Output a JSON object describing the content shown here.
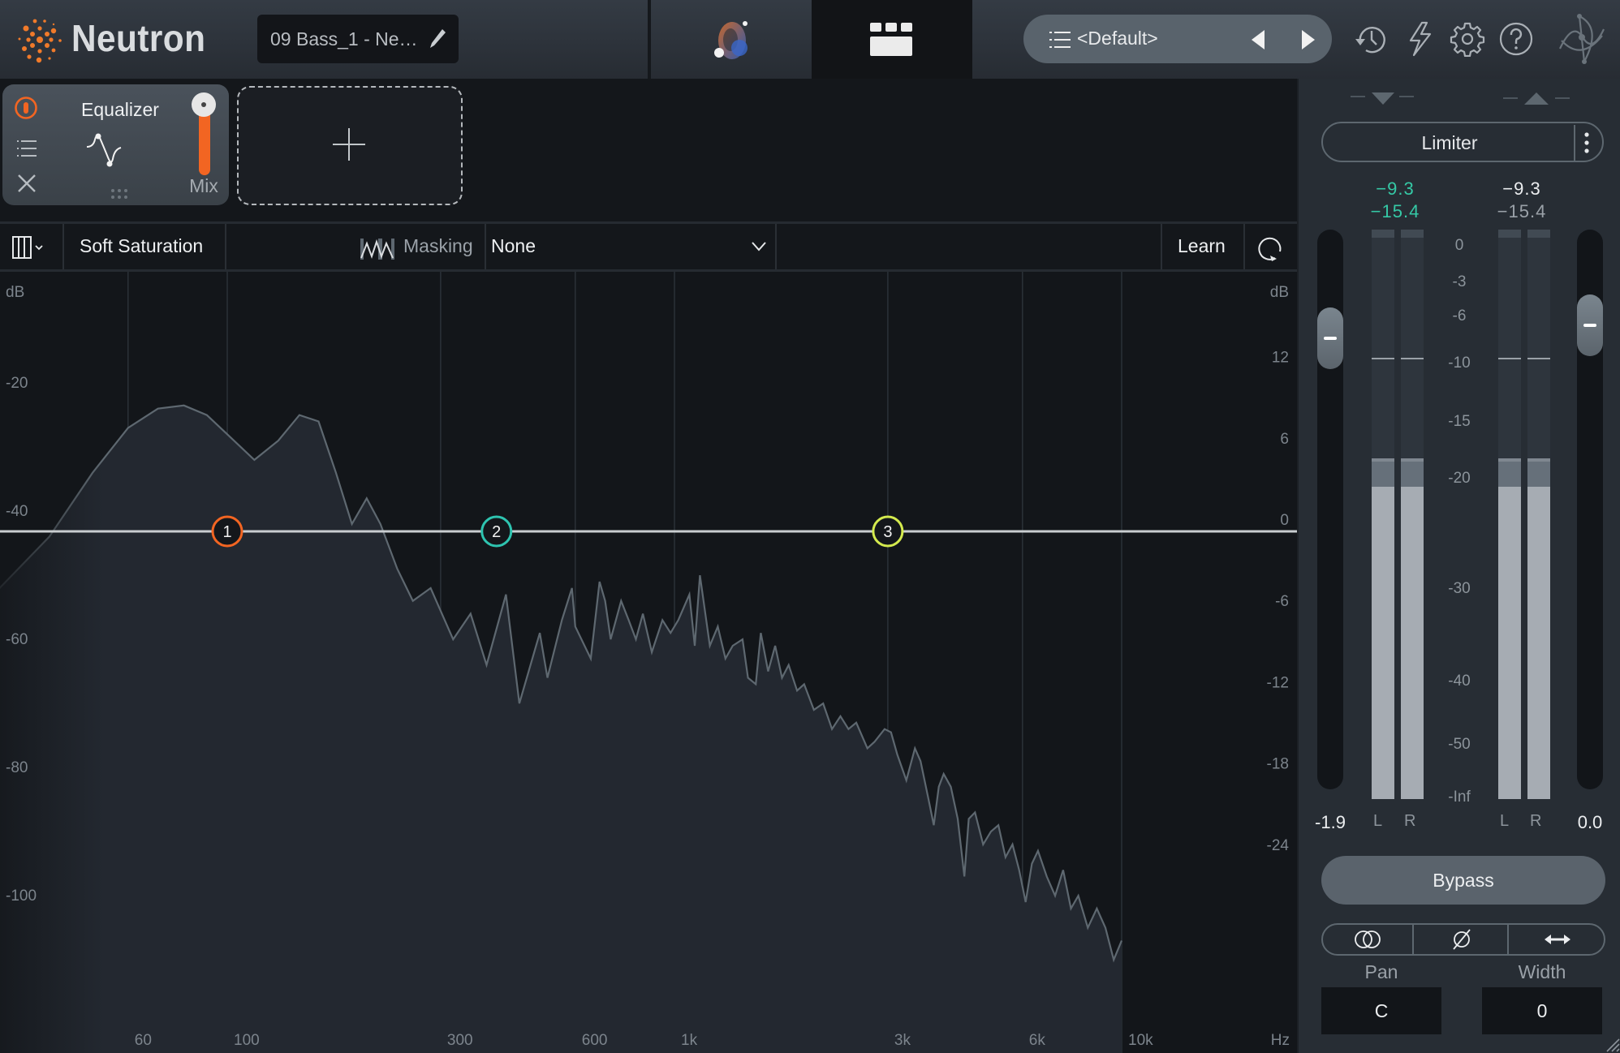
{
  "header": {
    "app_name": "Neutron",
    "preset_name": "09 Bass_1 - Ne…",
    "preset_selector": "<Default>",
    "icons": [
      "neutron-logo-icon",
      "pencil-icon",
      "visual-mixer-icon",
      "modules-view-icon",
      "list-icon",
      "previous-icon",
      "next-icon",
      "history-icon",
      "lightning-icon",
      "gear-icon",
      "help-icon",
      "izotope-logo-icon"
    ],
    "colors": {
      "logo_orange": "#f07a2a"
    }
  },
  "module_strip": {
    "modules": [
      {
        "name": "Equalizer",
        "mix_label": "Mix",
        "mix_value": 1.0,
        "power_color": "#f26522"
      }
    ],
    "add_module_symbol": "+"
  },
  "toolbar": {
    "view_button_icon": "columns-icon",
    "saturation_mode": "Soft Saturation",
    "masking_label": "Masking",
    "masking_source": "None",
    "learn_label": "Learn",
    "refresh_icon": "refresh-icon"
  },
  "eq_graph": {
    "left_axis_label": "dB",
    "left_axis_ticks": [
      "-20",
      "-40",
      "-60",
      "-80",
      "-100"
    ],
    "right_axis_label": "dB",
    "right_axis_ticks": [
      "12",
      "6",
      "0",
      "-6",
      "-12",
      "-18",
      "-24"
    ],
    "freq_axis_unit": "Hz",
    "freq_ticks": [
      {
        "label": "60",
        "hz": 60
      },
      {
        "label": "100",
        "hz": 100
      },
      {
        "label": "300",
        "hz": 300
      },
      {
        "label": "600",
        "hz": 600
      },
      {
        "label": "1k",
        "hz": 1000
      },
      {
        "label": "3k",
        "hz": 3000
      },
      {
        "label": "6k",
        "hz": 6000
      },
      {
        "label": "10k",
        "hz": 10000
      }
    ],
    "nodes": [
      {
        "label": "1",
        "hz": 100,
        "gain_db": 0,
        "color": "#f26522"
      },
      {
        "label": "2",
        "hz": 400,
        "gain_db": 0,
        "color": "#2ec4b0"
      },
      {
        "label": "3",
        "hz": 3000,
        "gain_db": 0,
        "color": "#d4ea4e"
      }
    ],
    "spectrum_db": [
      [
        20,
        -61
      ],
      [
        30,
        -52
      ],
      [
        40,
        -43
      ],
      [
        50,
        -33
      ],
      [
        60,
        -26
      ],
      [
        70,
        -23
      ],
      [
        80,
        -22.5
      ],
      [
        90,
        -24
      ],
      [
        100,
        -27
      ],
      [
        115,
        -31
      ],
      [
        130,
        -28
      ],
      [
        145,
        -24
      ],
      [
        160,
        -25
      ],
      [
        175,
        -33
      ],
      [
        190,
        -41
      ],
      [
        205,
        -37
      ],
      [
        220,
        -41
      ],
      [
        240,
        -48
      ],
      [
        260,
        -53
      ],
      [
        285,
        -51
      ],
      [
        320,
        -59
      ],
      [
        350,
        -55
      ],
      [
        380,
        -63
      ],
      [
        420,
        -52
      ],
      [
        450,
        -69
      ],
      [
        500,
        -58
      ],
      [
        520,
        -65
      ],
      [
        560,
        -56
      ],
      [
        590,
        -51
      ],
      [
        600,
        -57
      ],
      [
        650,
        -62
      ],
      [
        680,
        -50
      ],
      [
        700,
        -53
      ],
      [
        720,
        -59
      ],
      [
        760,
        -53
      ],
      [
        790,
        -56
      ],
      [
        820,
        -59
      ],
      [
        850,
        -55
      ],
      [
        890,
        -61
      ],
      [
        940,
        -56
      ],
      [
        980,
        -58
      ],
      [
        1020,
        -56
      ],
      [
        1080,
        -52
      ],
      [
        1110,
        -60
      ],
      [
        1140,
        -49
      ],
      [
        1200,
        -60
      ],
      [
        1250,
        -57
      ],
      [
        1300,
        -62
      ],
      [
        1350,
        -60
      ],
      [
        1420,
        -59
      ],
      [
        1460,
        -65
      ],
      [
        1520,
        -66
      ],
      [
        1560,
        -58
      ],
      [
        1620,
        -64
      ],
      [
        1680,
        -60
      ],
      [
        1740,
        -65
      ],
      [
        1800,
        -63
      ],
      [
        1880,
        -67
      ],
      [
        1950,
        -66
      ],
      [
        2050,
        -70
      ],
      [
        2150,
        -69
      ],
      [
        2250,
        -73
      ],
      [
        2350,
        -71
      ],
      [
        2450,
        -73
      ],
      [
        2550,
        -72
      ],
      [
        2700,
        -76
      ],
      [
        2800,
        -75
      ],
      [
        2950,
        -73
      ],
      [
        3050,
        -73.5
      ],
      [
        3150,
        -77
      ],
      [
        3300,
        -81
      ],
      [
        3450,
        -76
      ],
      [
        3550,
        -78
      ],
      [
        3700,
        -84
      ],
      [
        3800,
        -88
      ],
      [
        3900,
        -82
      ],
      [
        4000,
        -80
      ],
      [
        4150,
        -82
      ],
      [
        4300,
        -87
      ],
      [
        4450,
        -96
      ],
      [
        4550,
        -87
      ],
      [
        4700,
        -86
      ],
      [
        4900,
        -91
      ],
      [
        5100,
        -89
      ],
      [
        5300,
        -88
      ],
      [
        5500,
        -93
      ],
      [
        5700,
        -91
      ],
      [
        5900,
        -95
      ],
      [
        6100,
        -100
      ],
      [
        6300,
        -94
      ],
      [
        6500,
        -92
      ],
      [
        6800,
        -96
      ],
      [
        7100,
        -99
      ],
      [
        7400,
        -95
      ],
      [
        7700,
        -101
      ],
      [
        8000,
        -99
      ],
      [
        8400,
        -104
      ],
      [
        8800,
        -101
      ],
      [
        9200,
        -104
      ],
      [
        9600,
        -109
      ],
      [
        10000,
        -106
      ]
    ]
  },
  "output_panel": {
    "module_name": "Limiter",
    "more_icon": "kebab-menu-icon",
    "input_peak": "−9.3",
    "input_rms": "−15.4",
    "output_peak": "−9.3",
    "output_rms": "−15.4",
    "readout_color_input": "#35c9a6",
    "input_gain": "-1.9",
    "output_gain": "0.0",
    "input_gain_db": -1.9,
    "output_gain_db": 0.0,
    "meter_scale": [
      "0",
      "-3",
      "-6",
      "-10",
      "-15",
      "-20",
      "-30",
      "-40",
      "-50",
      "-Inf"
    ],
    "meter_channels": [
      "L",
      "R",
      "L",
      "R"
    ],
    "meters": {
      "input_L": {
        "peak_hold_db": -9.3,
        "peak_db": -18,
        "rms_db": -20.5
      },
      "input_R": {
        "peak_hold_db": -9.3,
        "peak_db": -18,
        "rms_db": -20.5
      },
      "output_L": {
        "peak_hold_db": -9.3,
        "peak_db": -18,
        "rms_db": -20.5
      },
      "output_R": {
        "peak_hold_db": -9.3,
        "peak_db": -18,
        "rms_db": -20.5
      }
    },
    "bypass_label": "Bypass",
    "stereo_buttons": [
      "mono-icon",
      "phase-invert-icon",
      "swap-channels-icon"
    ],
    "pan_label": "Pan",
    "pan_value": "C",
    "width_label": "Width",
    "width_value": "0"
  }
}
